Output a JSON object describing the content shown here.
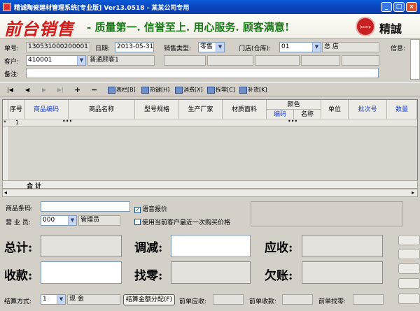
{
  "window": {
    "title": "精诚陶瓷建材管理系统[专业版] Ver13.0518 - 某某公司专用",
    "minimize": "_",
    "maximize": "□",
    "close": "×"
  },
  "banner": {
    "brand": "前台销售",
    "slogan": "- 质量第一. 信誉至上. 用心服务. 顾客满意!",
    "logo_small": "Jccorp",
    "logo_text": "精誠"
  },
  "form": {
    "order_no_label": "单号:",
    "order_no": "130531000200001",
    "date_label": "日期:",
    "date": "2013-05-31",
    "sales_type_label": "销售类型:",
    "sales_type": "零售",
    "store_label": "门店(仓库):",
    "store_code": "01",
    "store_name": "总 店",
    "info_label": "信息:",
    "customer_label": "客户:",
    "customer_code": "410001",
    "customer_name": "普通顾客1",
    "remark_label": "备注:",
    "remark": ""
  },
  "toolbar": {
    "table": "表栏[B]",
    "hotkey": "热键[H]",
    "consume": "消费[X]",
    "change": "拆零[C]",
    "restock": "补货[K]"
  },
  "grid": {
    "headers": {
      "seq": "序号",
      "item_code": "商品编码",
      "item_name": "商品名称",
      "model": "型号规格",
      "maker": "生产厂家",
      "material": "材质面料",
      "color": "颜色",
      "color_code": "编码",
      "color_name": "名称",
      "unit": "单位",
      "batch": "批次号",
      "qty": "数量"
    },
    "rows": [
      {
        "marker": "*",
        "seq": "1",
        "code_btn": "•••",
        "color_btn": "•••"
      }
    ],
    "total_label": "合 计"
  },
  "entry": {
    "barcode_label": "商品条码:",
    "barcode": "",
    "clerk_label": "营 业 员:",
    "clerk_code": "000",
    "clerk_name": "管理员",
    "voice_label": "语音报价",
    "voice_checked": true,
    "last_price_label": "使用当前客户最近一次购买价格",
    "last_price_checked": false
  },
  "totals": {
    "total_label": "总计:",
    "adjust_label": "调减:",
    "receivable_label": "应收:",
    "received_label": "收款:",
    "change_label": "找零:",
    "debt_label": "欠账:"
  },
  "footer": {
    "pay_method_label": "结算方式:",
    "pay_method_code": "1",
    "pay_method_name": "现 金",
    "allocate_button": "结算金额分配(F)",
    "prev_receivable_label": "前单应收:",
    "prev_received_label": "前单收款:",
    "prev_change_label": "前单找零:"
  }
}
